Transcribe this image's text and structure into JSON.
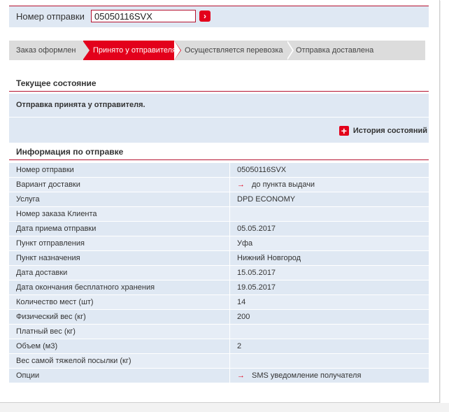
{
  "search": {
    "label": "Номер отправки",
    "value": "05050116SVX",
    "go_icon": "chevron-right-icon"
  },
  "steps": [
    "Заказ оформлен",
    "Принято у отправителя",
    "Осуществляется перевозка",
    "Отправка доставлена"
  ],
  "active_step": 2,
  "current_state": {
    "title": "Текущее состояние",
    "status": "Отправка принята у отправителя.",
    "history_label": "История состояний"
  },
  "info": {
    "title": "Информация по отправке",
    "rows": [
      {
        "label": "Номер отправки",
        "value": "05050116SVX",
        "arrow": false
      },
      {
        "label": "Вариант доставки",
        "value": "до пункта выдачи",
        "arrow": true
      },
      {
        "label": "Услуга",
        "value": "DPD ECONOMY",
        "arrow": false
      },
      {
        "label": "Номер заказа Клиента",
        "value": "",
        "arrow": false
      },
      {
        "label": "Дата приема отправки",
        "value": "05.05.2017",
        "arrow": false
      },
      {
        "label": "Пункт отправления",
        "value": "Уфа",
        "arrow": false
      },
      {
        "label": "Пункт назначения",
        "value": "Нижний Новгород",
        "arrow": false
      },
      {
        "label": "Дата доставки",
        "value": "15.05.2017",
        "arrow": false
      },
      {
        "label": "Дата окончания бесплатного хранения",
        "value": "19.05.2017",
        "arrow": false
      },
      {
        "label": "Количество мест (шт)",
        "value": "14",
        "arrow": false
      },
      {
        "label": "Физический вес (кг)",
        "value": "200",
        "arrow": false
      },
      {
        "label": "Платный вес (кг)",
        "value": "",
        "arrow": false
      },
      {
        "label": "Объем (м3)",
        "value": "2",
        "arrow": false
      },
      {
        "label": "Вес самой тяжелой посылки (кг)",
        "value": "",
        "arrow": false
      },
      {
        "label": "Опции",
        "value": "SMS уведомление получателя",
        "arrow": true
      }
    ]
  },
  "colors": {
    "accent": "#e3001b",
    "row_bg": "#dfe8f3",
    "step_bg": "#dcdcdc"
  }
}
